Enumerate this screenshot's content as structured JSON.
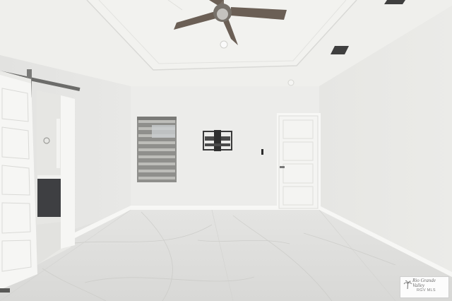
{
  "scene": {
    "description_type": "photo",
    "colors": {
      "wall_left": "#e4e4e2",
      "wall_back": "#ecece9",
      "wall_right": "#e7e7e4",
      "ceiling": "#efefec",
      "floor": "#dcdcda",
      "trim": "#f7f7f5",
      "door": "#f6f6f4",
      "fan_blade": "#6b5f55",
      "blind": "#8f8f8c",
      "vanity": "#3e3f42"
    }
  },
  "watermark": {
    "brand": "Rio Grande Valley",
    "mls": "RGV MLS"
  }
}
